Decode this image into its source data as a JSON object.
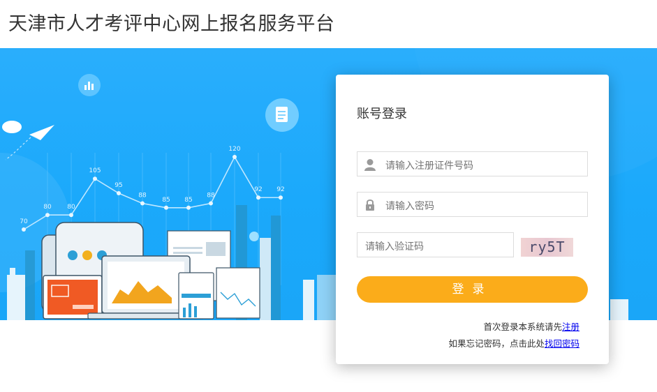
{
  "header": {
    "title": "天津市人才考评中心网上报名服务平台"
  },
  "banner": {
    "chart_data": {
      "type": "line",
      "values": [
        70,
        80,
        80,
        105,
        95,
        88,
        85,
        85,
        88,
        120,
        92,
        92
      ]
    }
  },
  "login": {
    "title": "账号登录",
    "username_placeholder": "请输入注册证件号码",
    "password_placeholder": "请输入密码",
    "captcha_placeholder": "请输入验证码",
    "captcha_text": "ry5T",
    "submit_label": "登录",
    "register_prompt": "首次登录本系统请先",
    "register_link": "注册",
    "forgot_prompt": "如果忘记密码，点击此处",
    "forgot_link": "找回密码"
  },
  "colors": {
    "banner_blue": "#1ba9fb",
    "button_orange": "#fbac1a",
    "link_blue": "#0000ee"
  }
}
